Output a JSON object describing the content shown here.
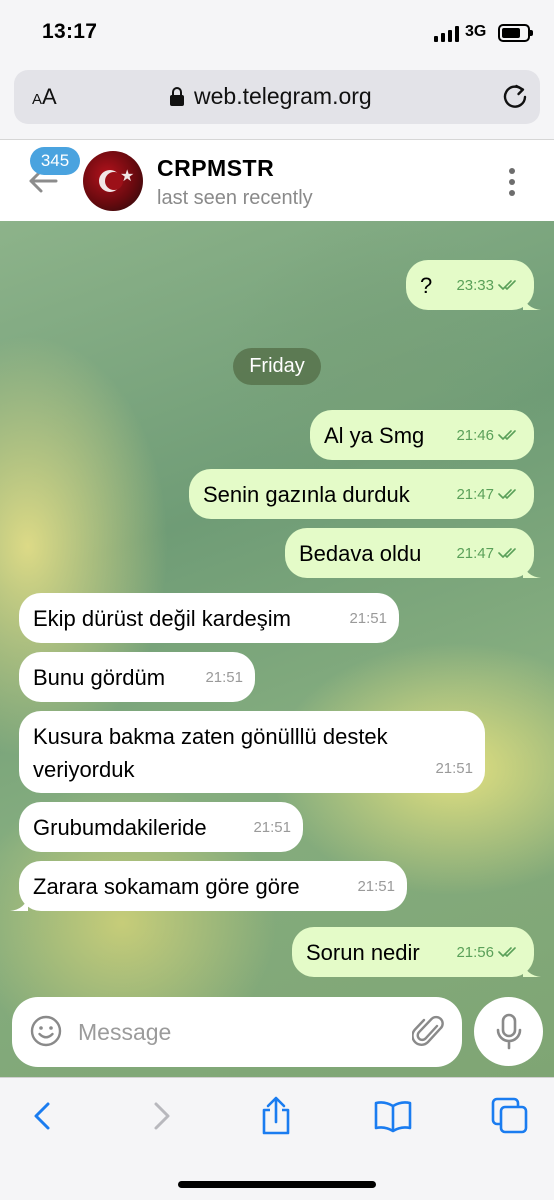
{
  "status_bar": {
    "time": "13:17",
    "network": "3G"
  },
  "browser": {
    "text_size_label_small": "A",
    "text_size_label_large": "A",
    "url": "web.telegram.org"
  },
  "chat": {
    "unread_count": "345",
    "title": "CRPMSTR",
    "status": "last seen recently"
  },
  "messages": [
    {
      "direction": "out",
      "text": "?",
      "time": "23:33",
      "read": true
    },
    {
      "type": "date",
      "text": "Friday"
    },
    {
      "direction": "out",
      "text": "Al ya Smg",
      "time": "21:46",
      "read": true
    },
    {
      "direction": "out",
      "text": "Senin gazınla durduk",
      "time": "21:47",
      "read": true
    },
    {
      "direction": "out",
      "text": "Bedava oldu",
      "time": "21:47",
      "read": true
    },
    {
      "direction": "in",
      "text": "Ekip dürüst değil kardeşim",
      "time": "21:51"
    },
    {
      "direction": "in",
      "text": "Bunu gördüm",
      "time": "21:51"
    },
    {
      "direction": "in",
      "text_line1": "Kusura bakma zaten gönülllü destek",
      "text_line2": "veriyorduk",
      "time": "21:51"
    },
    {
      "direction": "in",
      "text": "Grubumdakileride",
      "time": "21:51"
    },
    {
      "direction": "in",
      "text": "Zarara sokamam göre göre",
      "time": "21:51"
    },
    {
      "direction": "out",
      "text": "Sorun nedir",
      "time": "21:56",
      "read": true
    }
  ],
  "composer": {
    "placeholder": "Message",
    "value": ""
  },
  "colors": {
    "outgoing_bubble": "#e4fbc8",
    "incoming_bubble": "#ffffff",
    "read_ticks": "#5aa059",
    "unread_badge": "#4aa3df",
    "safari_accent": "#1a7cf0"
  },
  "icons": [
    "signal-icon",
    "battery-icon",
    "lock-icon",
    "reload-icon",
    "back-arrow-icon",
    "menu-dots-icon",
    "emoji-icon",
    "attach-icon",
    "mic-icon",
    "back-icon",
    "forward-icon",
    "share-icon",
    "bookmarks-icon",
    "tabs-icon"
  ]
}
